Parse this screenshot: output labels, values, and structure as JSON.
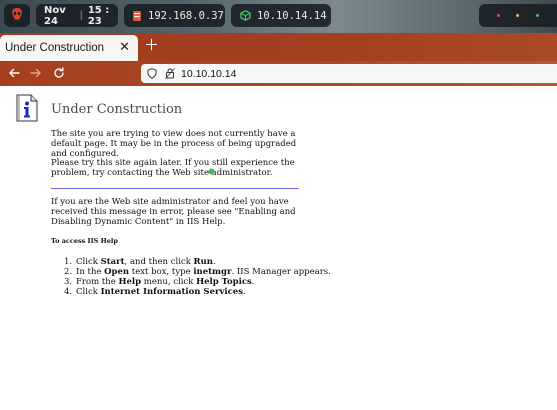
{
  "system_bar": {
    "logo_icon": "alien-skull-icon",
    "date": "Nov 24",
    "time": "15 : 23",
    "ip_local": "192.168.0.37",
    "ip_target": "10.10.14.14",
    "network_icon": "network-icon",
    "vpn_icon": "vpn-cube-icon",
    "status_dot_colors": [
      "#e05050",
      "#e8b84a",
      "#46c46a"
    ]
  },
  "browser": {
    "tab_title": "Under Construction",
    "url": "10.10.10.14",
    "accent_color": "#a33f20"
  },
  "page": {
    "title": "Under Construction",
    "paragraph1": "The site you are trying to view does not currently have a default page. It may be in the process of being upgraded and configured.",
    "paragraph2": "Please try this site again later. If you still experience the problem, try contacting the Web site administrator.",
    "paragraph3": "If you are the Web site administrator and feel you have received this message in error, please see \"Enabling and Disabling Dynamic Content\" in IIS Help.",
    "subheading": "To access IIS Help",
    "steps": [
      {
        "num": "1.",
        "pre": "Click ",
        "b1": "Start",
        "mid": ", and then click ",
        "b2": "Run",
        "post": "."
      },
      {
        "num": "2.",
        "pre": "In the ",
        "b1": "Open",
        "mid": " text box, type ",
        "b2": "inetmgr",
        "post": ". IIS Manager appears."
      },
      {
        "num": "3.",
        "pre": "From the ",
        "b1": "Help",
        "mid": " menu, click ",
        "b2": "Help Topics",
        "post": "."
      },
      {
        "num": "4.",
        "pre": "Click ",
        "b1": "Internet Information Services",
        "mid": "",
        "b2": "",
        "post": "."
      }
    ]
  }
}
